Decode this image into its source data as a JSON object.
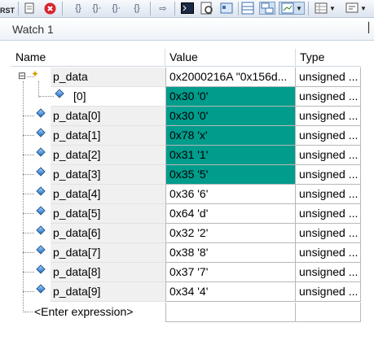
{
  "toolbar": {
    "icons": [
      "reset-icon",
      "page-icon",
      "stop-icon",
      "brace-icon",
      "brace-step-icon",
      "brace-step-over-icon",
      "brace-step-out-icon",
      "run-to-cursor-icon",
      "command-window-icon",
      "disassembly-icon",
      "symbols-icon",
      "registers-icon",
      "call-stack-icon",
      "watch-icon",
      "memory-icon",
      "serial-icon"
    ],
    "reset_label": "RST"
  },
  "panel": {
    "title": "Watch 1",
    "pin_glyph": "▕"
  },
  "columns": {
    "name": "Name",
    "value": "Value",
    "type": "Type"
  },
  "rows": [
    {
      "name": "p_data",
      "value": "0x2000216A \"0x156d...",
      "type": "unsigned ...",
      "expander": "⊟",
      "highlight": false,
      "indent": 1
    },
    {
      "name": "[0]",
      "value": "0x30 '0'",
      "type": "unsigned ...",
      "highlight": true,
      "indent": 2
    },
    {
      "name": "p_data[0]",
      "value": "0x30 '0'",
      "type": "unsigned ...",
      "highlight": true,
      "indent": 1
    },
    {
      "name": "p_data[1]",
      "value": "0x78 'x'",
      "type": "unsigned ...",
      "highlight": true,
      "indent": 1
    },
    {
      "name": "p_data[2]",
      "value": "0x31 '1'",
      "type": "unsigned ...",
      "highlight": true,
      "indent": 1
    },
    {
      "name": "p_data[3]",
      "value": "0x35 '5'",
      "type": "unsigned ...",
      "highlight": true,
      "indent": 1
    },
    {
      "name": "p_data[4]",
      "value": "0x36 '6'",
      "type": "unsigned ...",
      "highlight": false,
      "indent": 1
    },
    {
      "name": "p_data[5]",
      "value": "0x64 'd'",
      "type": "unsigned ...",
      "highlight": false,
      "indent": 1
    },
    {
      "name": "p_data[6]",
      "value": "0x32 '2'",
      "type": "unsigned ...",
      "highlight": false,
      "indent": 1
    },
    {
      "name": "p_data[7]",
      "value": "0x38 '8'",
      "type": "unsigned ...",
      "highlight": false,
      "indent": 1
    },
    {
      "name": "p_data[8]",
      "value": "0x37 '7'",
      "type": "unsigned ...",
      "highlight": false,
      "indent": 1
    },
    {
      "name": "p_data[9]",
      "value": "0x34 '4'",
      "type": "unsigned ...",
      "highlight": false,
      "indent": 1
    }
  ],
  "enter_expression": "<Enter expression>",
  "colors": {
    "highlight": "#009c8c",
    "name_bg": "#f0f0f0",
    "grid": "#b8b8b8"
  }
}
